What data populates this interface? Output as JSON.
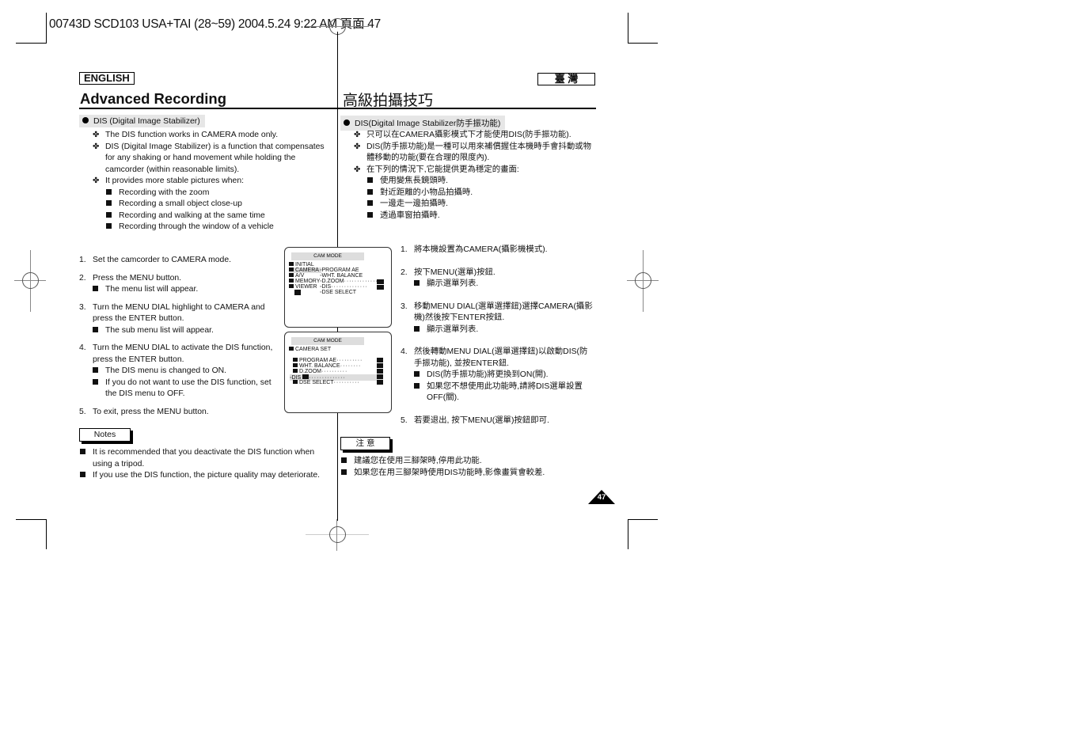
{
  "print_header": "00743D SCD103 USA+TAI (28~59)  2004.5.24  9:22 AM  頁面 47",
  "english": {
    "language_label": "ENGLISH",
    "title": "Advanced Recording",
    "section": "DIS (Digital Image Stabilizer)",
    "intro": [
      "The DIS function works in CAMERA mode only.",
      "DIS (Digital Image Stabilizer) is a function that compensates for any shaking or hand movement while holding the camcorder (within reasonable limits).",
      "It provides more stable pictures when:"
    ],
    "conditions": [
      "Recording with the zoom",
      "Recording a small object close-up",
      "Recording and walking at the same time",
      "Recording through the window of a vehicle"
    ],
    "steps": [
      {
        "n": "1.",
        "text": "Set the camcorder to CAMERA mode.",
        "subs": []
      },
      {
        "n": "2.",
        "text": "Press the MENU button.",
        "subs": [
          "The menu list will appear."
        ]
      },
      {
        "n": "3.",
        "text": "Turn the MENU DIAL highlight to CAMERA and press the ENTER button.",
        "subs": [
          "The sub menu list will appear."
        ]
      },
      {
        "n": "4.",
        "text": "Turn the MENU DIAL to activate the DIS function, press the ENTER button.",
        "subs": [
          "The DIS menu is changed to ON.",
          "If you do not want to use the DIS function, set the DIS menu to OFF."
        ]
      },
      {
        "n": "5.",
        "text": "To exit, press the MENU button.",
        "subs": []
      }
    ],
    "notes_label": "Notes",
    "notes": [
      "It is recommended that you deactivate the DIS function when using a tripod.",
      "If you use the DIS function, the picture quality may deteriorate."
    ]
  },
  "chinese": {
    "language_label": "臺 灣",
    "title": "高級拍攝技巧",
    "section": "DIS(Digital Image Stabilizer防手振功能)",
    "intro": [
      "只可以在CAMERA攝影模式下才能使用DIS(防手振功能).",
      "DIS(防手振功能)是一種可以用來補償握住本機時手會抖動或物體移動的功能(要在合理的限度內).",
      "在下列的情況下,它能提供更為穩定的畫面:"
    ],
    "conditions": [
      "使用變焦長鏡頭時.",
      "對近距離的小物品拍攝時.",
      "一邊走一邊拍攝時.",
      "透過車窗拍攝時."
    ],
    "steps": [
      {
        "n": "1.",
        "text": "將本機設置為CAMERA(攝影機模式).",
        "subs": []
      },
      {
        "n": "2.",
        "text": "按下MENU(選單)按鈕.",
        "subs": [
          "顯示選單列表."
        ]
      },
      {
        "n": "3.",
        "text": "移動MENU DIAL(選單選擇鈕)選擇CAMERA(攝影機)然後按下ENTER按鈕.",
        "subs": [
          "顯示選單列表."
        ]
      },
      {
        "n": "4.",
        "text": "然後轉動MENU DIAL(選單選擇鈕)以啟動DIS(防手振功能), 並按ENTER鈕.",
        "subs": [
          "DIS(防手振功能)將更換到ON(開).",
          "如果您不想使用此功能時,請將DIS選單設置OFF(關)."
        ]
      },
      {
        "n": "5.",
        "text": "若要退出, 按下MENU(選單)按鈕即可.",
        "subs": []
      }
    ],
    "notes_label": "注 意",
    "notes": [
      "建議您在使用三腳架時,停用此功能.",
      "如果您在用三腳架時使用DIS功能時,影像畫質會較差."
    ]
  },
  "screen1": {
    "mode_bar": "CAM MODE",
    "menu": [
      "INITIAL",
      "CAMERA",
      "A/V",
      "MEMORY",
      "VIEWER"
    ],
    "highlighted": "CAMERA",
    "submenu": [
      "PROGRAM AE",
      "WHT. BALANCE",
      "D.ZOOM",
      "DIS",
      "DSE SELECT"
    ]
  },
  "screen2": {
    "mode_bar": "CAM MODE",
    "heading": "CAMERA SET",
    "items": [
      "PROGRAM AE",
      "WHT. BALANCE",
      "D.ZOOM",
      "DIS",
      "DSE SELECT"
    ],
    "highlighted": "DIS"
  },
  "page_number": "47"
}
